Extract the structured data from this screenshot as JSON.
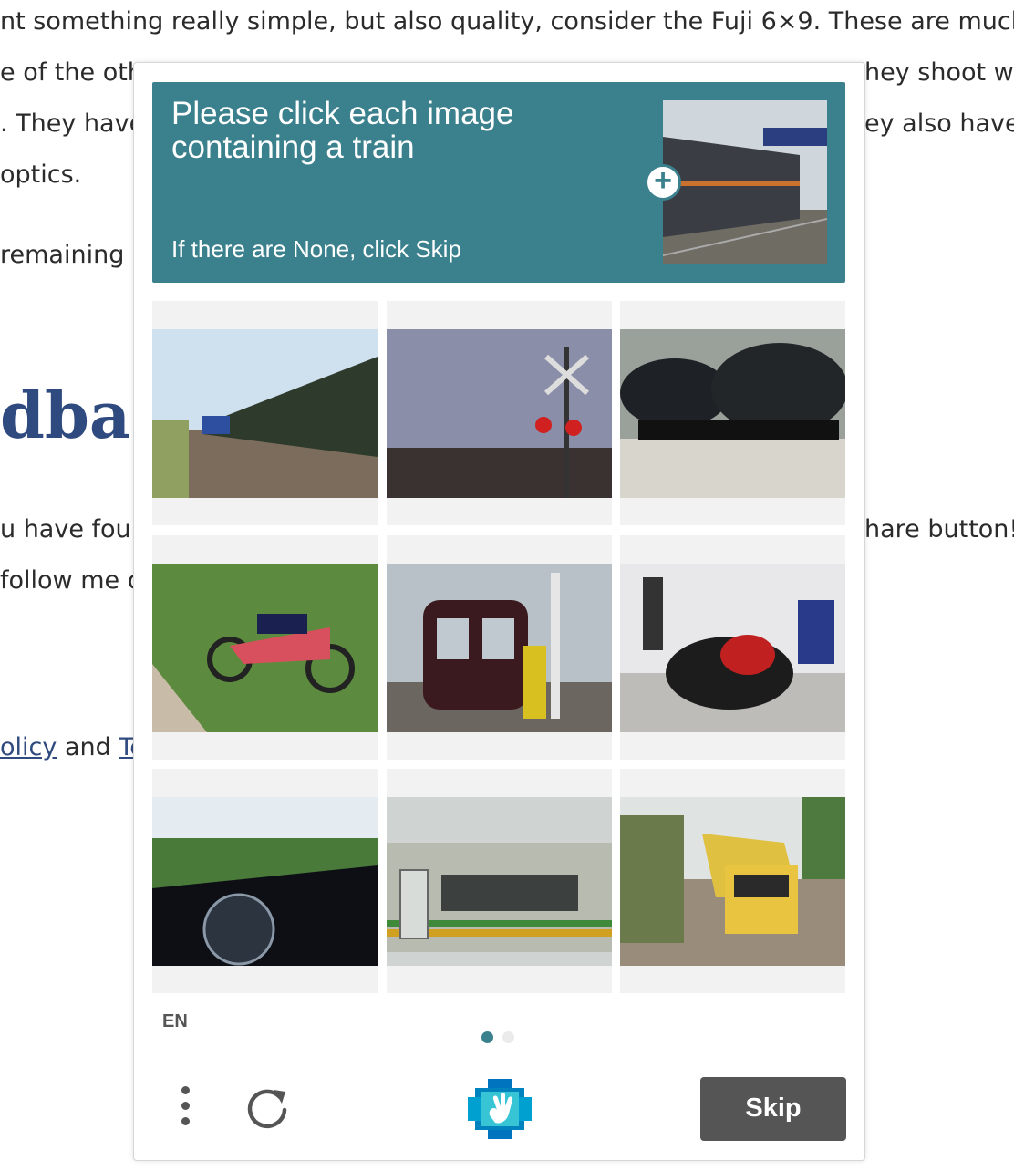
{
  "article": {
    "lines": [
      "nt something really simple, but also quality, consider the Fuji 6×9. These are much m",
      "e of the oth",
      "hey shoot wi",
      ". They have",
      "ey also have",
      "optics.",
      "remaining c",
      "u have four",
      "hare button!",
      "follow me o"
    ],
    "heading": "dbac",
    "links_line": {
      "link1": "olicy",
      "middle": " and ",
      "link2": "Te"
    }
  },
  "captcha": {
    "prompt": "Please click each image containing a train",
    "hint": "If there are None, click Skip",
    "example_image": "locomotive train example",
    "expand_icon": "plus-icon",
    "tiles": [
      "train with freight cars",
      "railroad crossing signal",
      "black tank cars",
      "red dirt motorcycle",
      "maroon commuter train",
      "motorcycles at expo",
      "motorcycle dashboard blur",
      "yellow-green passenger train",
      "yellow dump truck"
    ],
    "language": "EN",
    "pages": {
      "current": 1,
      "total": 2
    },
    "skip_label": "Skip",
    "accent": "#3b818d"
  }
}
